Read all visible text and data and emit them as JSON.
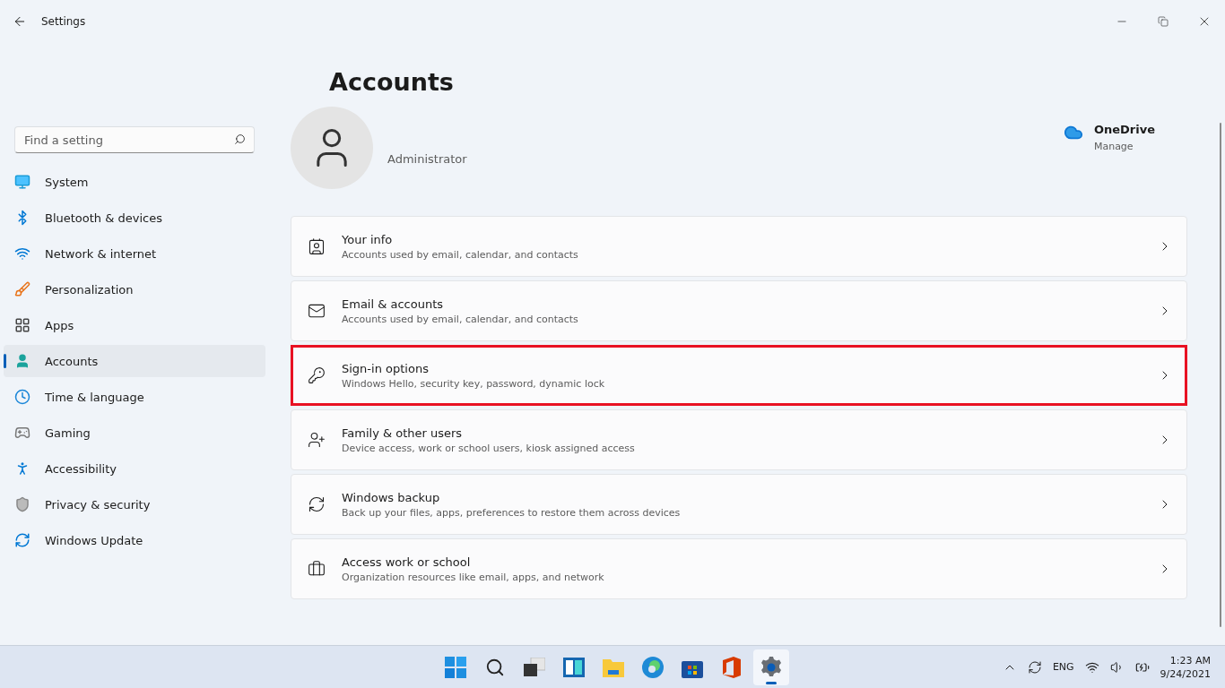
{
  "window": {
    "title": "Settings"
  },
  "search": {
    "placeholder": "Find a setting"
  },
  "sidebar": {
    "items": [
      {
        "label": "System",
        "selected": false
      },
      {
        "label": "Bluetooth & devices",
        "selected": false
      },
      {
        "label": "Network & internet",
        "selected": false
      },
      {
        "label": "Personalization",
        "selected": false
      },
      {
        "label": "Apps",
        "selected": false
      },
      {
        "label": "Accounts",
        "selected": true
      },
      {
        "label": "Time & language",
        "selected": false
      },
      {
        "label": "Gaming",
        "selected": false
      },
      {
        "label": "Accessibility",
        "selected": false
      },
      {
        "label": "Privacy & security",
        "selected": false
      },
      {
        "label": "Windows Update",
        "selected": false
      }
    ]
  },
  "page": {
    "heading": "Accounts",
    "user_name": "Administrator",
    "onedrive": {
      "title": "OneDrive",
      "link": "Manage"
    }
  },
  "cards": [
    {
      "title": "Your info",
      "subtitle": "Accounts used by email, calendar, and contacts",
      "highlighted": false
    },
    {
      "title": "Email & accounts",
      "subtitle": "Accounts used by email, calendar, and contacts",
      "highlighted": false
    },
    {
      "title": "Sign-in options",
      "subtitle": "Windows Hello, security key, password, dynamic lock",
      "highlighted": true
    },
    {
      "title": "Family & other users",
      "subtitle": "Device access, work or school users, kiosk assigned access",
      "highlighted": false
    },
    {
      "title": "Windows backup",
      "subtitle": "Back up your files, apps, preferences to restore them across devices",
      "highlighted": false
    },
    {
      "title": "Access work or school",
      "subtitle": "Organization resources like email, apps, and network",
      "highlighted": false
    }
  ],
  "taskbar": {
    "apps": [
      {
        "selected": false
      },
      {
        "selected": false
      },
      {
        "selected": false
      },
      {
        "selected": false
      },
      {
        "selected": false
      },
      {
        "selected": false
      },
      {
        "selected": false
      },
      {
        "selected": false
      },
      {
        "selected": true
      }
    ],
    "language": "ENG",
    "time": "1:23 AM",
    "date": "9/24/2021"
  }
}
